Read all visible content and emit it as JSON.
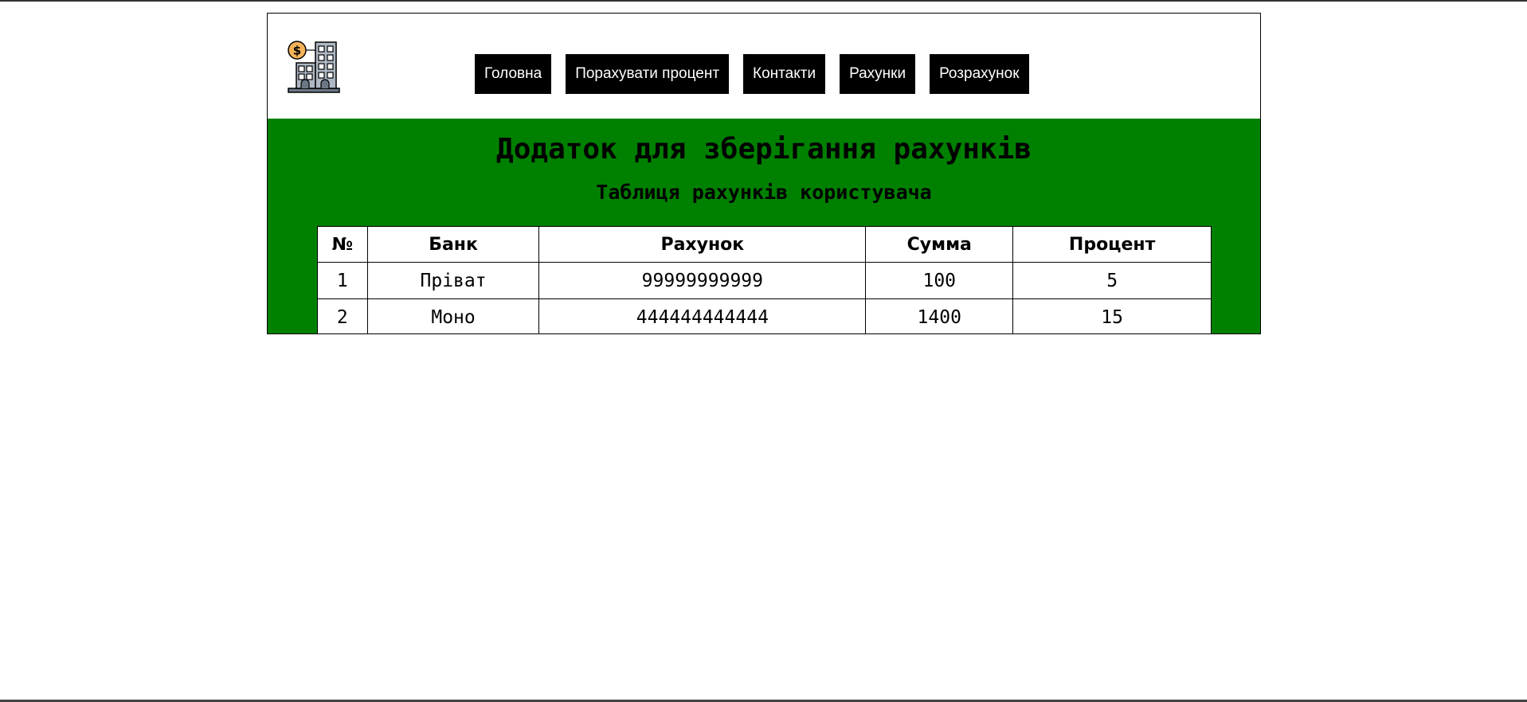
{
  "header": {
    "logo_icon": "bank-building-with-dollar-coin-icon",
    "nav": [
      {
        "label": "Головна"
      },
      {
        "label": "Порахувати процент"
      },
      {
        "label": "Контакти"
      },
      {
        "label": "Рахунки"
      },
      {
        "label": "Розрахунок"
      }
    ]
  },
  "main": {
    "title": "Додаток для зберігання рахунків",
    "subtitle": "Таблиця рахунків користувача",
    "background_color": "#008000"
  },
  "table": {
    "headers": [
      "№",
      "Банк",
      "Рахунок",
      "Сумма",
      "Процент"
    ],
    "rows": [
      [
        "1",
        "Пріват",
        "99999999999",
        "100",
        "5"
      ],
      [
        "2",
        "Моно",
        "444444444444",
        "1400",
        "15"
      ]
    ]
  }
}
